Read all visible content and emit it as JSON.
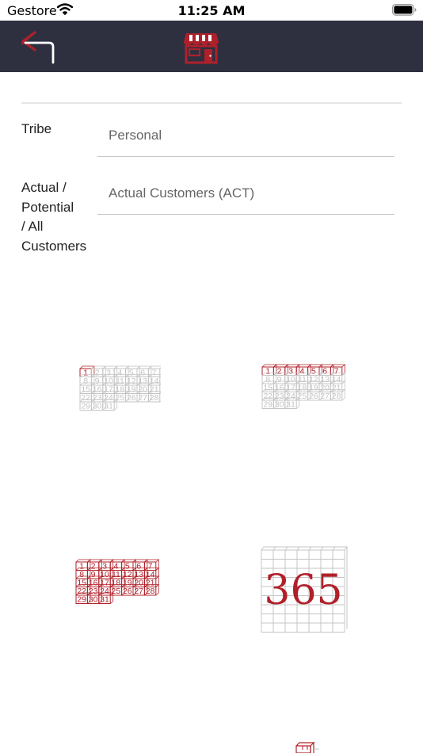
{
  "status_bar": {
    "carrier": "Gestore",
    "time": "11:25 AM"
  },
  "header": {
    "back_icon": "back-arrow-icon",
    "center_icon": "store-icon"
  },
  "form": {
    "tribe": {
      "label": "Tribe",
      "value": "Personal"
    },
    "customers": {
      "label_lines": [
        "Actual /",
        "Potential",
        "/ All",
        "Customers"
      ],
      "value": "Actual Customers (ACT)"
    }
  },
  "periods": {
    "day": {
      "icon": "calendar-day-icon"
    },
    "week": {
      "icon": "calendar-week-icon"
    },
    "month": {
      "icon": "calendar-month-icon"
    },
    "year": {
      "icon": "calendar-year-icon",
      "text": "365"
    },
    "custom": {
      "icon": "calendar-custom-icon"
    }
  },
  "colors": {
    "accent": "#b0202a",
    "nav_background": "#2e3040",
    "faint_grid": "#c4c4c4"
  }
}
